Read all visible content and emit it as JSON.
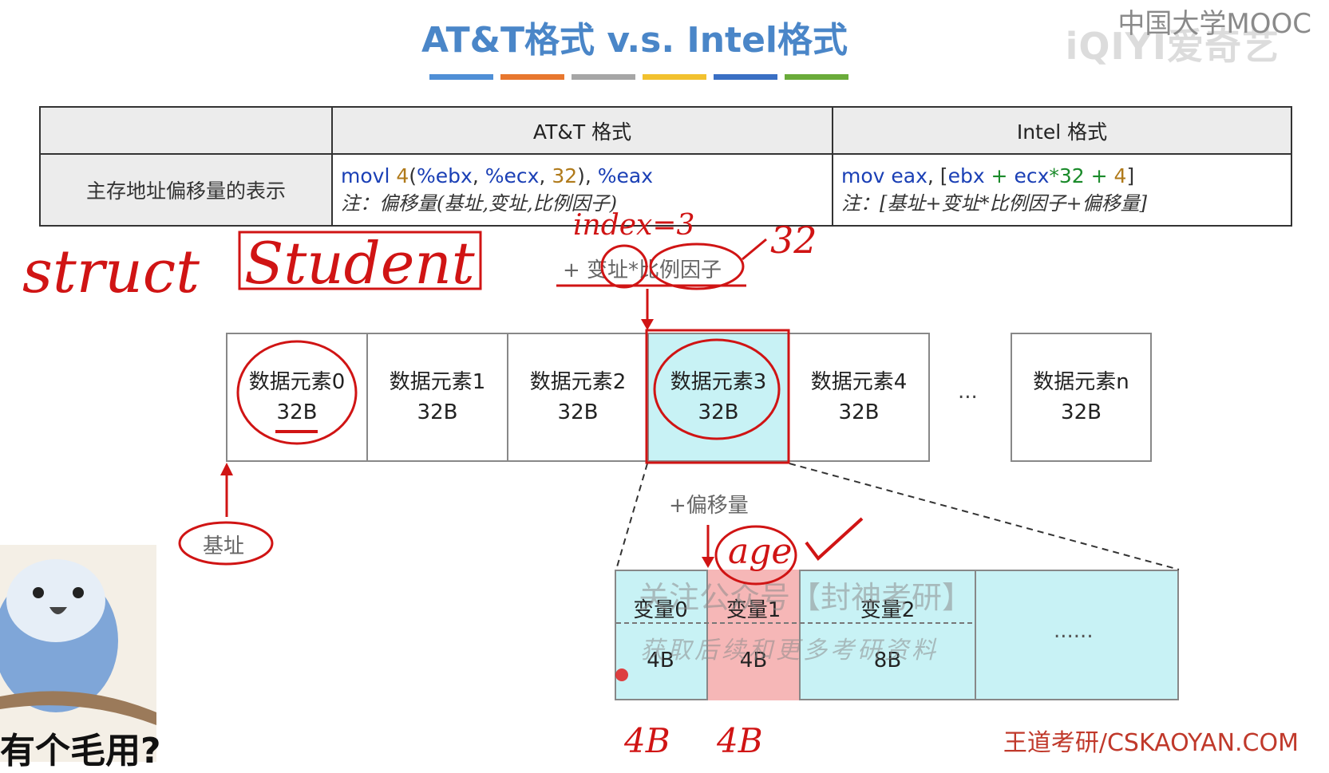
{
  "title": "AT&T格式 v.s. Intel格式",
  "logos": {
    "mooc": "中国大学MOOC",
    "iqiyi": "iQIYI爱奇艺"
  },
  "accent_colors": [
    "#4f8fd6",
    "#e8772e",
    "#a6a6a6",
    "#f2c12e",
    "#3a6fc4",
    "#6aab3a"
  ],
  "table": {
    "headers": [
      "",
      "AT&T 格式",
      "Intel 格式"
    ],
    "row_label": "主存地址偏移量的表示",
    "att": {
      "op": "movl",
      "disp": "4",
      "base": "%ebx",
      "index": "%ecx",
      "scale": "32",
      "dest": "%eax",
      "note": "注：偏移量(基址,变址,比例因子)"
    },
    "intel": {
      "op": "mov",
      "dest": "eax",
      "base": "ebx",
      "index": "ecx",
      "scale_expr": "*32",
      "disp": "4",
      "note": "注：[基址+变址*比例因子+偏移量]"
    }
  },
  "array": {
    "cells": [
      {
        "name": "数据元素0",
        "size": "32B"
      },
      {
        "name": "数据元素1",
        "size": "32B"
      },
      {
        "name": "数据元素2",
        "size": "32B"
      },
      {
        "name": "数据元素3",
        "size": "32B"
      },
      {
        "name": "数据元素4",
        "size": "32B"
      },
      {
        "name": "数据元素n",
        "size": "32B"
      }
    ],
    "ellipsis": "..."
  },
  "labels": {
    "index_scale": "+ 变址*比例因子",
    "offset": "+偏移量",
    "base": "基址"
  },
  "struct": {
    "vars": [
      {
        "name": "变量0",
        "size": "4B"
      },
      {
        "name": "变量1",
        "size": "4B"
      },
      {
        "name": "变量2",
        "size": "8B"
      }
    ],
    "ellipsis": "......"
  },
  "watermark": {
    "line1": "关注公众号【封神考研】",
    "line2": "获取后续和更多考研资料"
  },
  "handwriting": {
    "struct": "struct",
    "student": "Student",
    "index": "index=3",
    "scale": "32",
    "age": "age",
    "size_a": "4B",
    "size_b": "4B"
  },
  "footer": "王道考研/CSKAOYAN.COM",
  "subtitle_tail": "有个毛用?"
}
